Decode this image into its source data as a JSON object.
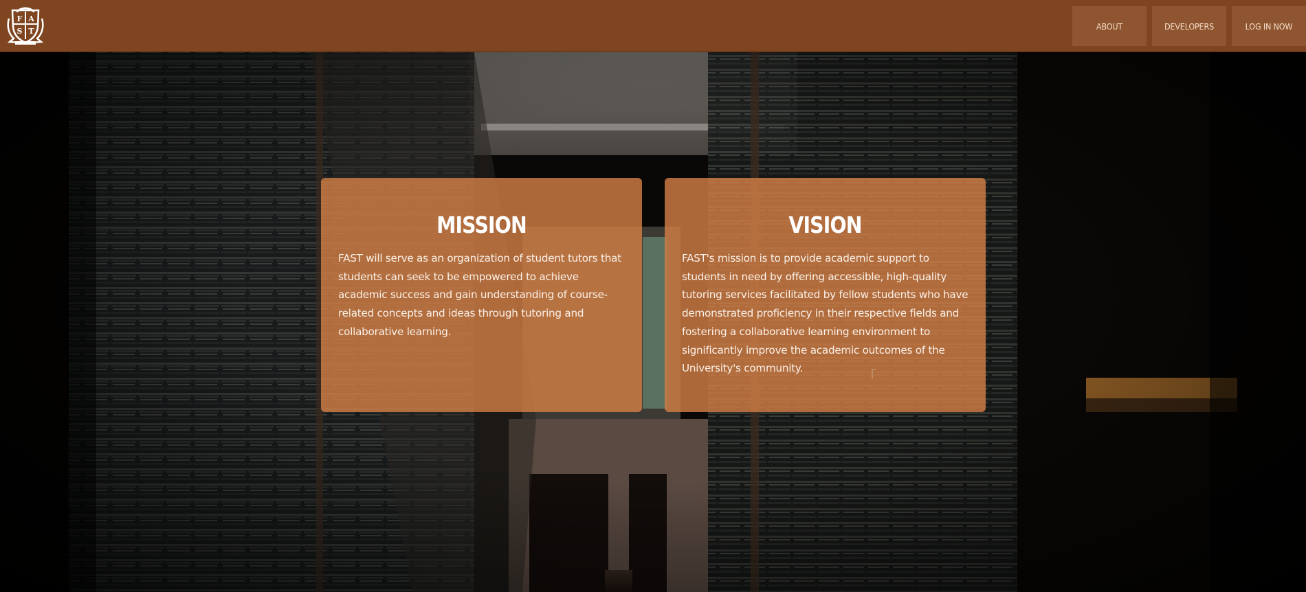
{
  "nav": {
    "about": "ABOUT",
    "developers": "DEVELOPERS",
    "login": "LOG IN NOW"
  },
  "logo": {
    "letters": "FAST"
  },
  "mission": {
    "title": "MISSION",
    "text": "FAST will serve as an organization of student tutors that students can seek to be empowered to achieve academic success and gain understanding of course-related concepts and ideas through tutoring and collaborative learning."
  },
  "vision": {
    "title": "VISION",
    "text": "FAST's mission is to provide academic support to students in need by offering accessible, high-quality tutoring services facilitated by fellow students who have demonstrated proficiency in their respective fields and fostering a collaborative learning environment to significantly improve the academic outcomes of the University's community."
  },
  "colors": {
    "header": "#7e4520",
    "nav_button": "#8f5530",
    "card": "#d68146"
  }
}
